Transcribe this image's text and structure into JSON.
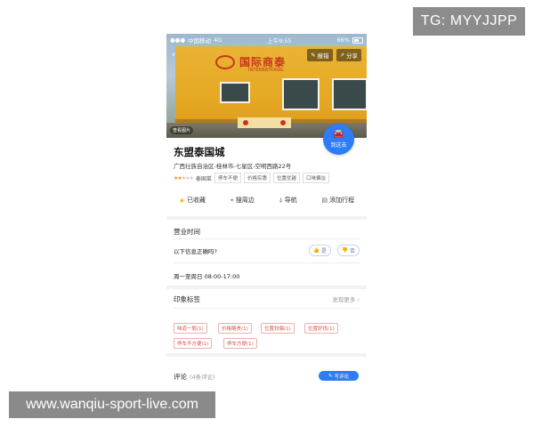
{
  "watermark_top": "TG: MYYJJPP",
  "watermark_bottom": "www.wanqiu-sport-live.com",
  "status_bar": {
    "carrier": "中国移动",
    "network": "4G",
    "time": "上午9:55",
    "battery": "66%"
  },
  "hero": {
    "sign_text": "国际商泰",
    "sign_subtext": "INTERNATIONAL",
    "report_button": "报错",
    "share_button": "分享",
    "photo_label": "查看图片"
  },
  "go_button": {
    "label": "到这去",
    "icon": "car-icon"
  },
  "place": {
    "name": "东盟泰国城",
    "address": "广西壮族自治区-桂林市-七星区-空明西路22号",
    "rating_stars": 2.5,
    "tags": [
      "泰国菜",
      "停车不便",
      "价格实惠",
      "位置优越",
      "口味偏淡"
    ]
  },
  "actions": [
    {
      "label": "已收藏",
      "icon": "star-icon"
    },
    {
      "label": "搜周边",
      "icon": "location-pin-icon"
    },
    {
      "label": "导航",
      "icon": "navigation-arrow-icon"
    },
    {
      "label": "添加行程",
      "icon": "calendar-icon"
    }
  ],
  "hours": {
    "title": "营业时间",
    "question": "以下信息正确吗?",
    "yes_label": "是",
    "no_label": "否",
    "schedule": "周一至周日 08:00-17:00"
  },
  "impressions": {
    "title": "印象标签",
    "more_label": "发现更多",
    "tags": [
      "味道一般(1)",
      "价格略贵(1)",
      "位置较偏(1)",
      "位置好找(1)",
      "停车不方便(1)",
      "停车方便(1)"
    ]
  },
  "comments": {
    "title": "评论",
    "count_label": "(4条评论)",
    "write_label": "写评论"
  },
  "colors": {
    "accent": "#2e7cf6",
    "tag_red": "#d0584c",
    "star_yellow": "#f5b400",
    "building_yellow": "#e5a823"
  }
}
